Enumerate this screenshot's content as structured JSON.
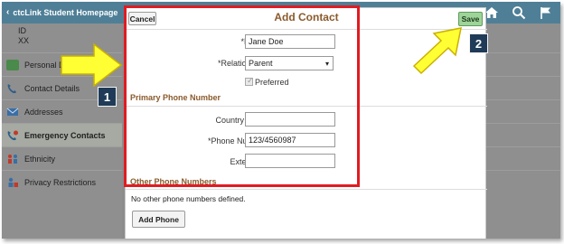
{
  "header": {
    "home_label": "ctcLink Student Homepage",
    "icons": [
      "home-icon",
      "search-icon",
      "flag-icon"
    ]
  },
  "sidebar": {
    "id_label": "ID",
    "id_value": "XX",
    "items": [
      {
        "label": "Personal Details",
        "icon": "person-card-icon"
      },
      {
        "label": "Contact Details",
        "icon": "phone-icon"
      },
      {
        "label": "Addresses",
        "icon": "envelope-icon"
      },
      {
        "label": "Emergency Contacts",
        "icon": "emergency-phone-icon",
        "active": true
      },
      {
        "label": "Ethnicity",
        "icon": "people-icon"
      },
      {
        "label": "Privacy Restrictions",
        "icon": "lock-person-icon"
      }
    ]
  },
  "modal": {
    "title": "Add Contact",
    "cancel_label": "Cancel",
    "save_label": "Save",
    "name_label": "*Name",
    "name_value": "Jane Doe",
    "relationship_label": "*Relationship",
    "relationship_value": "Parent",
    "preferred_label": "Preferred",
    "primary_phone_title": "Primary Phone Number",
    "country_code_label": "Country Code",
    "country_code_value": "",
    "phone_number_label": "*Phone Number",
    "phone_number_value": "123/4560987",
    "extension_label": "Extension",
    "extension_value": "",
    "other_phone_title": "Other Phone Numbers",
    "no_other_phones": "No other phone numbers defined.",
    "add_phone_label": "Add Phone"
  },
  "callouts": {
    "one": "1",
    "two": "2"
  },
  "colors": {
    "highlight": "#e11b22",
    "arrow": "#ffff33",
    "callout_bg": "#1f3b57",
    "save_bg": "#9ed39a",
    "section_title": "#8a5a2b"
  }
}
